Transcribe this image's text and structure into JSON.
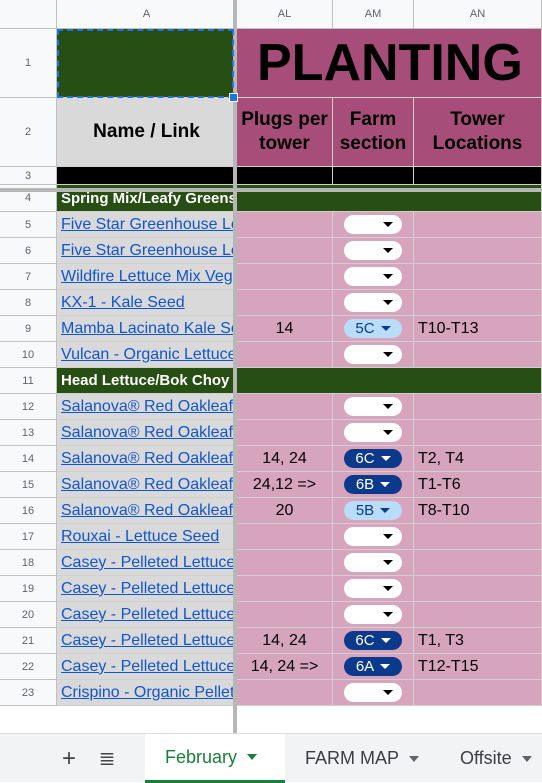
{
  "columns": {
    "a": "A",
    "al": "AL",
    "am": "AM",
    "an": "AN"
  },
  "header": {
    "title": "PLANTING",
    "name_link": "Name / Link",
    "plugs_per_tower": "Plugs per tower",
    "farm_section": "Farm section",
    "tower_locations": "Tower Locations"
  },
  "rows": [
    {
      "num": "1"
    },
    {
      "num": "2"
    },
    {
      "num": "3"
    },
    {
      "num": "4",
      "section": "Spring Mix/Leafy Greens"
    },
    {
      "num": "5",
      "name": "Five Star Greenhouse Lettuce Mix",
      "plugs": "",
      "farm": "",
      "tower": ""
    },
    {
      "num": "6",
      "name": "Five Star Greenhouse Lettuce Mix",
      "plugs": "",
      "farm": "",
      "tower": ""
    },
    {
      "num": "7",
      "name": "Wildfire Lettuce Mix Vegetable Seed",
      "plugs": "",
      "farm": "",
      "tower": ""
    },
    {
      "num": "8",
      "name": "KX-1 - Kale Seed",
      "plugs": "",
      "farm": "",
      "tower": ""
    },
    {
      "num": "9",
      "name": "Mamba Lacinato Kale Seed",
      "plugs": "14",
      "farm": "5C",
      "farm_style": "light",
      "tower": "T10-T13"
    },
    {
      "num": "10",
      "name": "Vulcan - Organic Lettuce Seed",
      "plugs": "",
      "farm": "",
      "tower": ""
    },
    {
      "num": "11",
      "section": "Head Lettuce/Bok Choy"
    },
    {
      "num": "12",
      "name": "Salanova® Red Oakleaf Lettuce",
      "plugs": "",
      "farm": "",
      "tower": ""
    },
    {
      "num": "13",
      "name": "Salanova® Red Oakleaf Lettuce",
      "plugs": "",
      "farm": "",
      "tower": ""
    },
    {
      "num": "14",
      "name": "Salanova® Red Oakleaf Lettuce",
      "plugs": "14, 24",
      "farm": "6C",
      "farm_style": "dark",
      "tower": "T2, T4"
    },
    {
      "num": "15",
      "name": "Salanova® Red Oakleaf Lettuce",
      "plugs": "24,12 =>",
      "farm": "6B",
      "farm_style": "dark",
      "tower": "T1-T6"
    },
    {
      "num": "16",
      "name": "Salanova® Red Oakleaf Lettuce",
      "plugs": "20",
      "farm": "5B",
      "farm_style": "light",
      "tower": "T8-T10"
    },
    {
      "num": "17",
      "name": "Rouxai - Lettuce Seed",
      "plugs": "",
      "farm": "",
      "tower": ""
    },
    {
      "num": "18",
      "name": "Casey - Pelleted Lettuce Seed",
      "plugs": "",
      "farm": "",
      "tower": ""
    },
    {
      "num": "19",
      "name": "Casey - Pelleted Lettuce Seed",
      "plugs": "",
      "farm": "",
      "tower": ""
    },
    {
      "num": "20",
      "name": "Casey - Pelleted Lettuce Seed",
      "plugs": "",
      "farm": "",
      "tower": ""
    },
    {
      "num": "21",
      "name": "Casey - Pelleted Lettuce Seed",
      "plugs": "14, 24",
      "farm": "6C",
      "farm_style": "dark",
      "tower": "T1, T3"
    },
    {
      "num": "22",
      "name": "Casey - Pelleted Lettuce Seed",
      "plugs": "14, 24 =>",
      "farm": "6A",
      "farm_style": "dark",
      "tower": "T12-T15"
    },
    {
      "num": "23",
      "name": "Crispino - Organic Pelleted Lettuce Seed",
      "plugs": "",
      "farm": "",
      "tower": ""
    }
  ],
  "tabs": {
    "add_label": "+",
    "list_label": "≣",
    "items": [
      "February",
      "FARM MAP",
      "Offsite"
    ],
    "active": "February"
  },
  "colors": {
    "pink": "#d6a4bd",
    "green": "#274e13",
    "header_pink": "#a64d79",
    "chip_dark": "#0b3a8c",
    "chip_light": "#b9dcf8"
  }
}
